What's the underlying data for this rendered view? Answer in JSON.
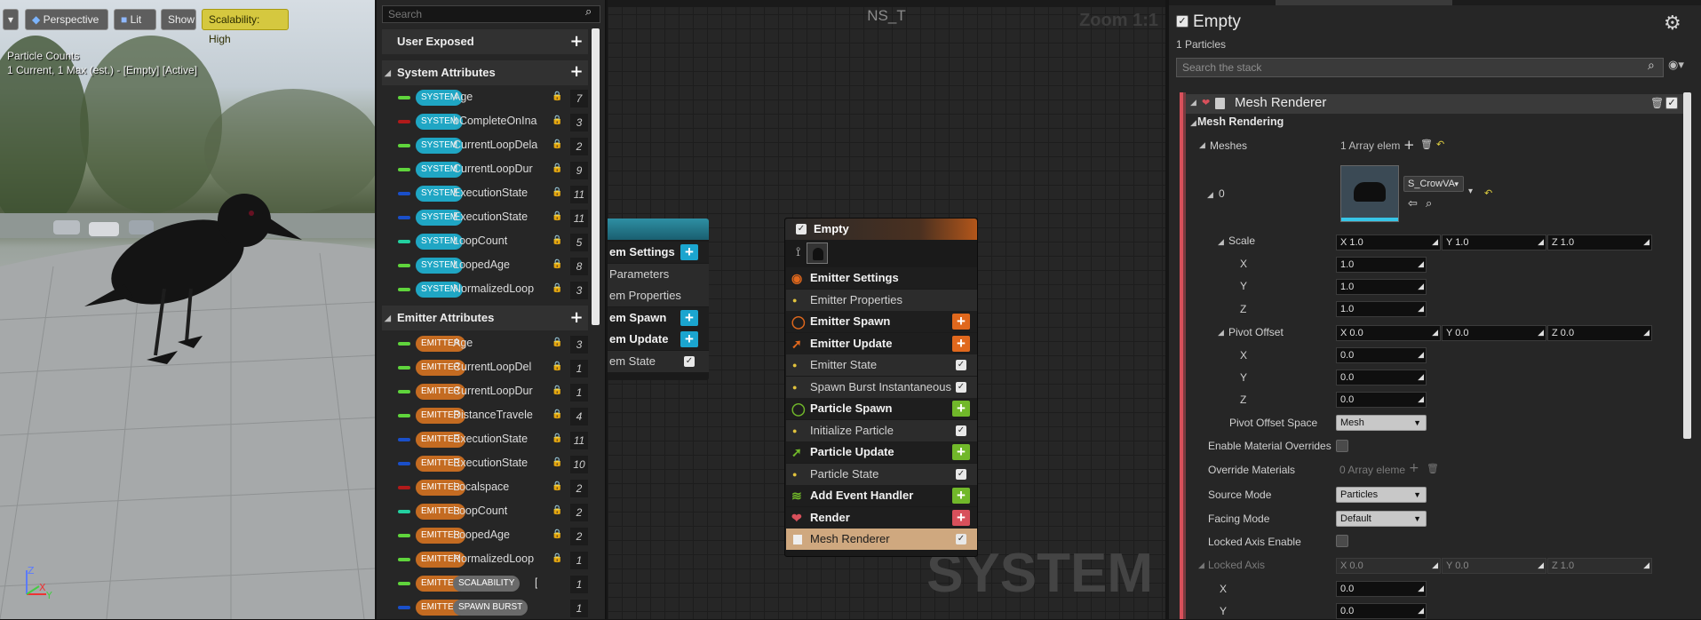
{
  "viewport": {
    "toolbar": {
      "dropdown": "▾",
      "perspective": "Perspective",
      "lit": "Lit",
      "show": "Show",
      "scalability": "Scalability: High"
    },
    "overlay_title": "Particle Counts",
    "overlay_detail": "1 Current, 1 Max (est.) - [Empty] [Active]",
    "axis": {
      "z": "Z",
      "x": "X",
      "y": "Y"
    }
  },
  "params": {
    "search_placeholder": "Search",
    "user_exposed": "User Exposed",
    "system_header": "System Attributes",
    "emitter_header": "Emitter Attributes",
    "system_rows": [
      {
        "badge": "SYSTEM",
        "name": "Age",
        "count": "7",
        "color": "#5fd43c"
      },
      {
        "badge": "SYSTEM",
        "name": "bCompleteOnIna",
        "count": "3",
        "color": "#b11a1a"
      },
      {
        "badge": "SYSTEM",
        "name": "CurrentLoopDela",
        "count": "2",
        "color": "#5fd43c"
      },
      {
        "badge": "SYSTEM",
        "name": "CurrentLoopDur",
        "count": "9",
        "color": "#5fd43c"
      },
      {
        "badge": "SYSTEM",
        "name": "ExecutionState",
        "count": "11",
        "color": "#1a4fc9"
      },
      {
        "badge": "SYSTEM",
        "name": "ExecutionState",
        "count": "11",
        "color": "#1a4fc9"
      },
      {
        "badge": "SYSTEM",
        "name": "LoopCount",
        "count": "5",
        "color": "#23d0a0"
      },
      {
        "badge": "SYSTEM",
        "name": "LoopedAge",
        "count": "8",
        "color": "#5fd43c"
      },
      {
        "badge": "SYSTEM",
        "name": "NormalizedLoop",
        "count": "3",
        "color": "#5fd43c"
      }
    ],
    "emitter_rows": [
      {
        "badge": "EMITTER",
        "name": "Age",
        "count": "3",
        "color": "#5fd43c"
      },
      {
        "badge": "EMITTER",
        "name": "CurrentLoopDel",
        "count": "1",
        "color": "#5fd43c"
      },
      {
        "badge": "EMITTER",
        "name": "CurrentLoopDur",
        "count": "1",
        "color": "#5fd43c"
      },
      {
        "badge": "EMITTER",
        "name": "DistanceTravele",
        "count": "4",
        "color": "#5fd43c"
      },
      {
        "badge": "EMITTER",
        "name": "ExecutionState",
        "count": "11",
        "color": "#1a4fc9"
      },
      {
        "badge": "EMITTER",
        "name": "ExecutionState",
        "count": "10",
        "color": "#1a4fc9"
      },
      {
        "badge": "EMITTER",
        "name": "Localspace",
        "count": "2",
        "color": "#b11a1a"
      },
      {
        "badge": "EMITTER",
        "name": "LoopCount",
        "count": "2",
        "color": "#23d0a0"
      },
      {
        "badge": "EMITTER",
        "name": "LoopedAge",
        "count": "2",
        "color": "#5fd43c"
      },
      {
        "badge": "EMITTER",
        "name": "NormalizedLoop",
        "count": "1",
        "color": "#5fd43c"
      },
      {
        "badge": "EMITTER",
        "name": "SCALABILITY",
        "count": "1",
        "color": "#5fd43c",
        "badge2": "SCALABILITY",
        "extra": "["
      },
      {
        "badge": "EMITTER",
        "name": "SPAWN BURST",
        "count": "1",
        "color": "#1a4fc9",
        "badge2": "SPAWN BURST"
      }
    ]
  },
  "graph": {
    "title": "NS_T",
    "zoom": "Zoom 1:1",
    "watermark": "SYSTEM",
    "system_node": {
      "rows": [
        "em Settings",
        "Parameters",
        "em Properties",
        "em Spawn",
        "em Update",
        "em State"
      ]
    },
    "emitter_node": {
      "title": "Empty",
      "rows": [
        {
          "label": "Emitter Settings",
          "kind": "header",
          "icon_color": "#e0681d"
        },
        {
          "label": "Emitter Properties",
          "kind": "item"
        },
        {
          "label": "Emitter Spawn",
          "kind": "header",
          "icon_color": "#e0681d",
          "plus": "#e0681d"
        },
        {
          "label": "Emitter Update",
          "kind": "header",
          "icon_color": "#e0681d",
          "plus": "#e0681d"
        },
        {
          "label": "Emitter State",
          "kind": "item",
          "check": true
        },
        {
          "label": "Spawn Burst Instantaneous",
          "kind": "item",
          "check": true
        },
        {
          "label": "Particle Spawn",
          "kind": "header",
          "icon_color": "#71b82a",
          "plus": "#71b82a"
        },
        {
          "label": "Initialize Particle",
          "kind": "item",
          "check": true
        },
        {
          "label": "Particle Update",
          "kind": "header",
          "icon_color": "#71b82a",
          "plus": "#71b82a"
        },
        {
          "label": "Particle State",
          "kind": "item",
          "check": true
        },
        {
          "label": "Add Event Handler",
          "kind": "header",
          "icon_color": "#71b82a",
          "plus": "#71b82a"
        },
        {
          "label": "Render",
          "kind": "header",
          "icon_color": "#d8505b",
          "plus": "#d8505b"
        },
        {
          "label": "Mesh Renderer",
          "kind": "selected",
          "check": true
        }
      ]
    }
  },
  "details": {
    "title": "Empty",
    "particles": "1 Particles",
    "search_placeholder": "Search the stack",
    "module": "Mesh Renderer",
    "category": "Mesh Rendering",
    "meshes_label": "Meshes",
    "meshes_value": "1 Array elem",
    "index0": "0",
    "mesh_name": "S_CrowVA",
    "scale": {
      "label": "Scale",
      "x": "X 1.0",
      "y": "Y 1.0",
      "z": "Z 1.0",
      "xv": "1.0",
      "yv": "1.0",
      "zv": "1.0"
    },
    "pivot": {
      "label": "Pivot Offset",
      "x": "X 0.0",
      "y": "Y 0.0",
      "z": "Z 0.0",
      "xv": "0.0",
      "yv": "0.0",
      "zv": "0.0"
    },
    "pivot_space_label": "Pivot Offset Space",
    "pivot_space_value": "Mesh",
    "mat_overrides_label": "Enable Material Overrides",
    "override_materials_label": "Override Materials",
    "override_materials_value": "0 Array eleme",
    "source_mode_label": "Source Mode",
    "source_mode_value": "Particles",
    "facing_mode_label": "Facing Mode",
    "facing_mode_value": "Default",
    "locked_axis_enable_label": "Locked Axis Enable",
    "locked_axis": {
      "label": "Locked Axis",
      "x": "X 0.0",
      "y": "Y 0.0",
      "z": "Z 1.0",
      "xv": "0.0",
      "yv": "0.0"
    },
    "x": "X",
    "y": "Y",
    "z": "Z"
  }
}
